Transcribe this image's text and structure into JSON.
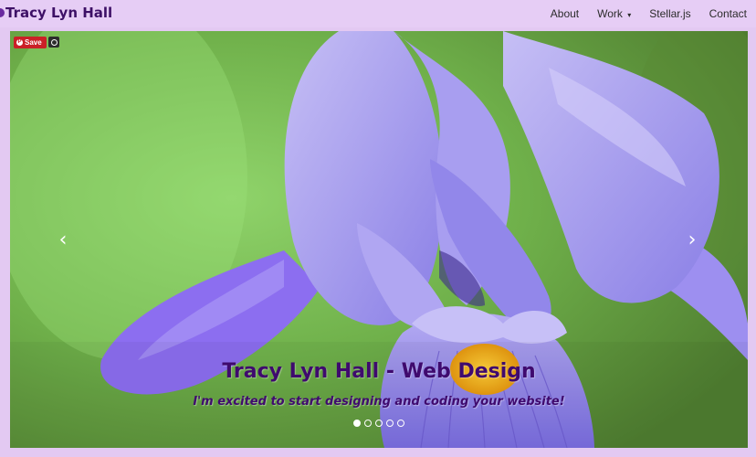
{
  "navbar": {
    "brand": "Tracy Lyn Hall",
    "items": [
      {
        "label": "About"
      },
      {
        "label": "Work",
        "caret": "▾"
      },
      {
        "label": "Stellar.js"
      },
      {
        "label": "Contact"
      }
    ]
  },
  "pin": {
    "save_label": "Save",
    "pin_glyph": "P"
  },
  "carousel": {
    "prev_glyph": "‹",
    "next_glyph": "›",
    "caption_title": "Tracy Lyn Hall - Web Design",
    "caption_subtitle": "I'm excited to start designing and coding your website!",
    "slide_count": 5,
    "active_index": 0
  },
  "colors": {
    "page_bg": "#e3c9f2",
    "brand_text": "#3d1066",
    "caption_text": "#3f0a6e",
    "pin_red": "#cb2027"
  }
}
